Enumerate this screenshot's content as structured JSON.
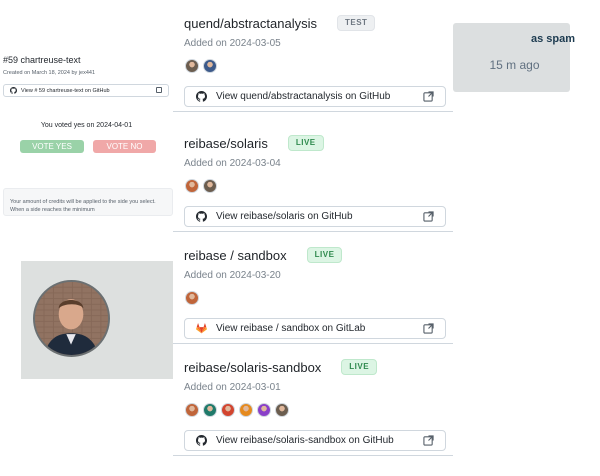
{
  "vote_card": {
    "title": "#59 chartreuse-text",
    "created": "Created on March 18, 2024 by jex441",
    "github_button": "View # 59 chartreuse-text on GitHub",
    "voted_on": "You voted yes on 2024-04-01",
    "vote_yes": "VOTE YES",
    "vote_no": "VOTE NO",
    "credits_text": "Your amount of credits will be applied to the side you select. When a side reaches the minimum"
  },
  "spam_card": {
    "label": "as spam",
    "time": "15 m ago"
  },
  "repos": [
    {
      "name": "quend/abstractanalysis",
      "badge": "TEST",
      "badge_kind": "test",
      "added": "Added on 2024-03-05",
      "avatars": [
        "#6b5d4f",
        "#3d5a8a"
      ],
      "button": "View quend/abstractanalysis on GitHub",
      "provider": "github"
    },
    {
      "name": "reibase/solaris",
      "badge": "LIVE",
      "badge_kind": "live",
      "added": "Added on 2024-03-04",
      "avatars": [
        "#c0653a",
        "#6b5d4f"
      ],
      "button": "View reibase/solaris on GitHub",
      "provider": "github"
    },
    {
      "name": "reibase / sandbox",
      "badge": "LIVE",
      "badge_kind": "live",
      "added": "Added on 2024-03-20",
      "avatars": [
        "#c0653a"
      ],
      "button": "View reibase / sandbox on GitLab",
      "provider": "gitlab"
    },
    {
      "name": "reibase/solaris-sandbox",
      "badge": "LIVE",
      "badge_kind": "live",
      "added": "Added on 2024-03-01",
      "avatars": [
        "#c0653a",
        "#1f7a6a",
        "#d2452f",
        "#e58a1f",
        "#8a3fc8",
        "#6b5d4f"
      ],
      "button": "View reibase/solaris-sandbox on GitHub",
      "provider": "github"
    }
  ]
}
